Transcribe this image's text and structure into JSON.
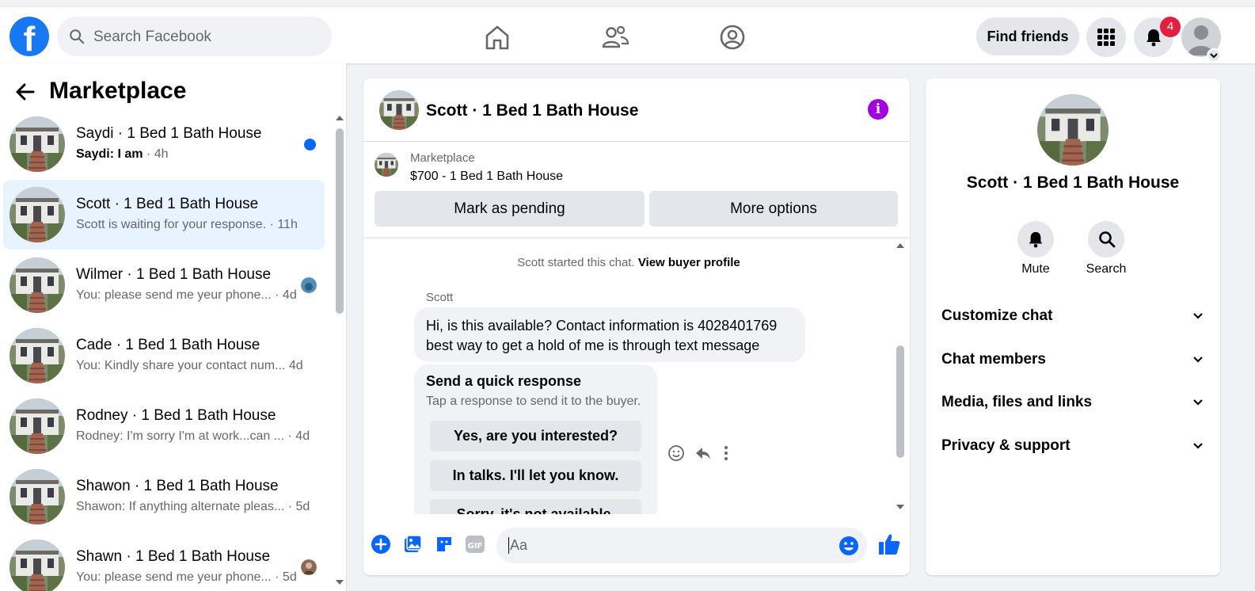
{
  "topbar": {
    "logo_letter": "f",
    "search_placeholder": "Search Facebook",
    "find_friends_label": "Find friends",
    "notification_count": "4",
    "nav_icons": [
      "home-icon",
      "friends-icon",
      "groups-icon"
    ]
  },
  "sidebar": {
    "title": "Marketplace",
    "conversations": [
      {
        "name": "Saydi · 1 Bed 1 Bath House",
        "preview": "Saydi: I am",
        "time": " · 4h",
        "unread": true
      },
      {
        "name": "Scott · 1 Bed 1 Bath House",
        "preview": "Scott is waiting for your response.",
        "time": " · 11h",
        "active": true
      },
      {
        "name": "Wilmer · 1 Bed 1 Bath House",
        "preview": "You: please send me yeur phone...",
        "time": " · 4d"
      },
      {
        "name": "Cade · 1 Bed 1 Bath House",
        "preview": "You: Kindly share your contact num...",
        "time": " 4d"
      },
      {
        "name": "Rodney · 1 Bed 1 Bath House",
        "preview": "Rodney: I'm sorry I'm at work...can ...",
        "time": " · 4d"
      },
      {
        "name": "Shawon · 1 Bed 1 Bath House",
        "preview": "Shawon: If anything alternate pleas...",
        "time": " · 5d"
      },
      {
        "name": "Shawn · 1 Bed 1 Bath House",
        "preview": "You: please send me yeur phone...",
        "time": " · 5d"
      }
    ]
  },
  "chat": {
    "title": "Scott · 1 Bed 1 Bath House",
    "listing_source": "Marketplace",
    "listing_price_title": "$700 - 1 Bed 1 Bath House",
    "mark_pending_label": "Mark as pending",
    "more_options_label": "More options",
    "started_text": "Scott started this chat.",
    "view_buyer_label": "View buyer profile",
    "sender_name": "Scott",
    "message_text": "Hi, is this available? Contact information is 4028401769 best way to get a hold of me is through text message",
    "quick_title": "Send a quick response",
    "quick_subtitle": "Tap a response to send it to the buyer.",
    "quick_responses": [
      "Yes, are you interested?",
      "In talks. I'll let you know.",
      "Sorry, it's not available."
    ],
    "composer_placeholder": "Aa",
    "composer_icons": [
      "plus-icon",
      "photo-icon",
      "sticker-icon",
      "gif-icon",
      "emoji-icon",
      "like-icon"
    ]
  },
  "info_panel": {
    "name": "Scott · 1 Bed 1 Bath House",
    "mute_label": "Mute",
    "search_label": "Search",
    "sections": [
      "Customize chat",
      "Chat members",
      "Media, files and links",
      "Privacy & support"
    ]
  },
  "colors": {
    "brand_blue": "#1877f2",
    "active_bg": "#e7f3ff",
    "info_purple": "#a400e0",
    "badge_red": "#e41e3f"
  }
}
